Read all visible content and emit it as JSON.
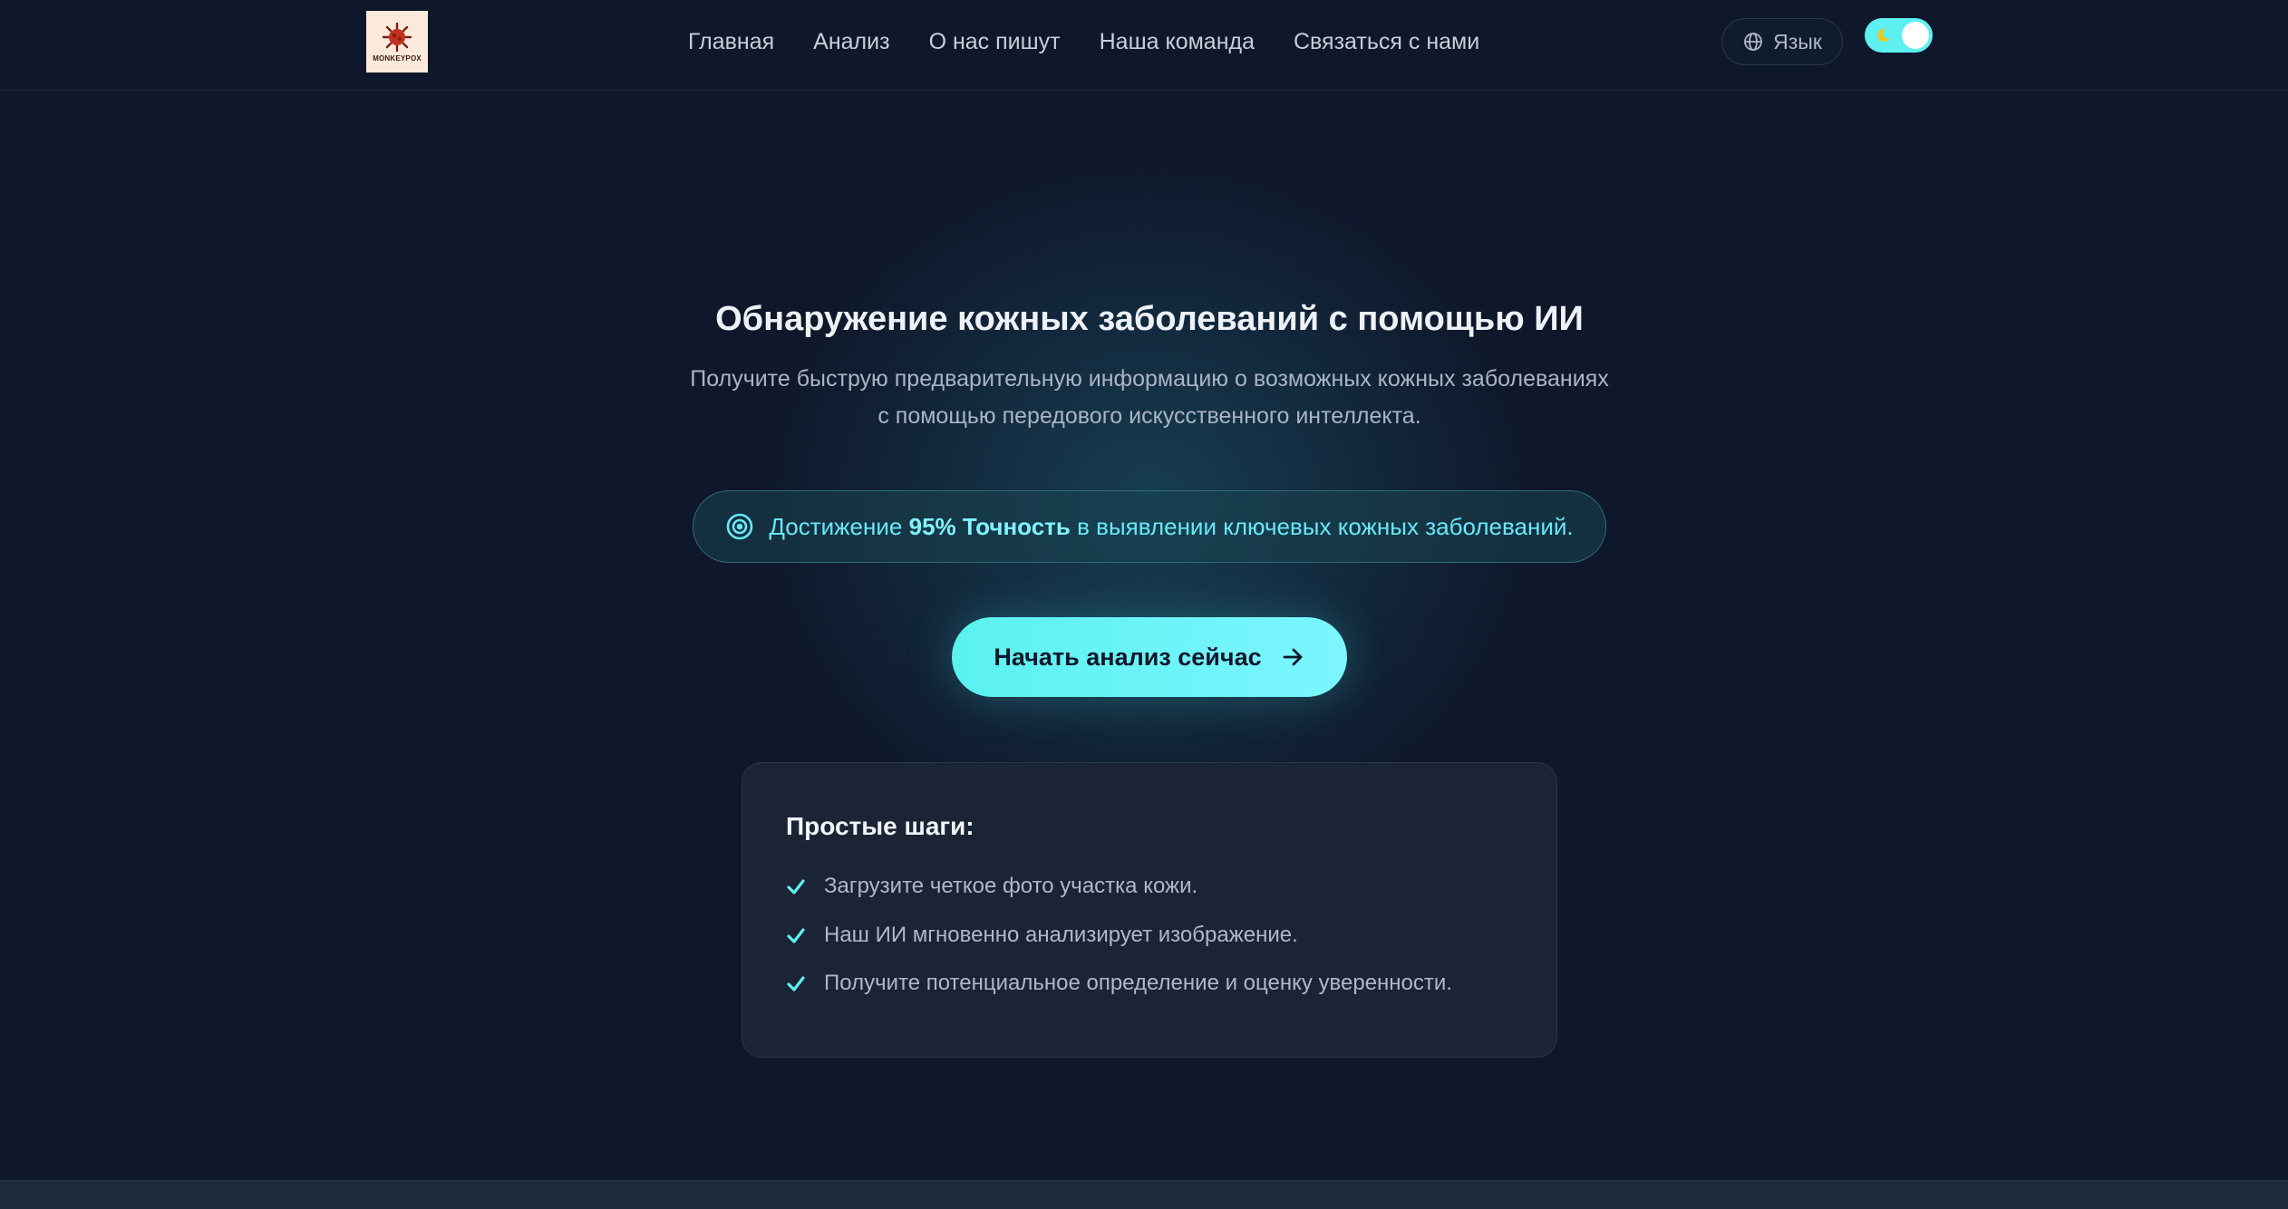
{
  "header": {
    "logo_text": "MONKEYPOX",
    "nav": [
      "Главная",
      "Анализ",
      "О нас пишут",
      "Наша команда",
      "Связаться с нами"
    ],
    "language_label": "Язык",
    "theme_toggle_state": "dark"
  },
  "hero": {
    "title": "Обнаружение кожных заболеваний с помощью ИИ",
    "subtitle_line1": "Получите быструю предварительную информацию о возможных кожных заболеваниях",
    "subtitle_line2": "с помощью передового искусственного интеллекта.",
    "accuracy_prefix": "Достижение",
    "accuracy_value": "95% Точность",
    "accuracy_suffix": "в выявлении ключевых кожных заболеваний.",
    "cta_label": "Начать анализ сейчас"
  },
  "steps": {
    "title": "Простые шаги:",
    "items": [
      "Загрузите четкое фото участка кожи.",
      "Наш ИИ мгновенно анализирует изображение.",
      "Получите потенциальное определение и оценку уверенности."
    ]
  },
  "colors": {
    "background": "#0f172a",
    "accent": "#5ef0f0",
    "card": "#1b2435"
  }
}
